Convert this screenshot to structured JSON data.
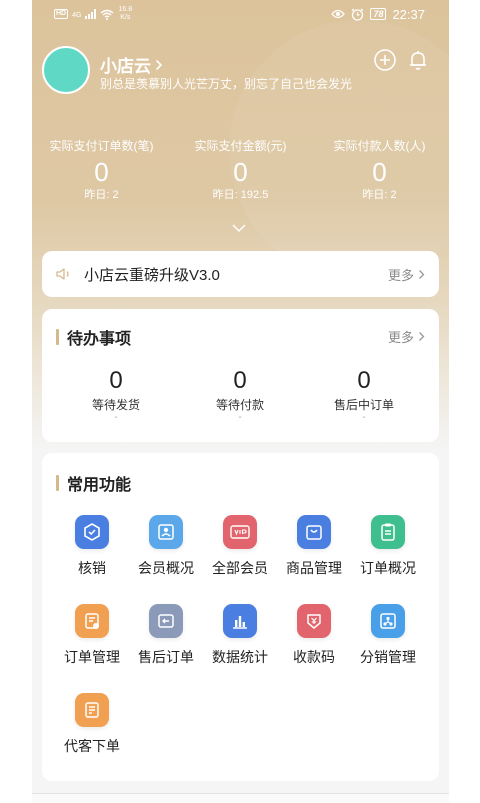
{
  "status_bar": {
    "net_badge": "HD",
    "net_type": "4G",
    "speed_value": "16.8",
    "speed_unit": "K/s",
    "battery": "78",
    "time": "22:37"
  },
  "profile": {
    "shop_name": "小店云",
    "motto": "别总是羡慕别人光芒万丈，别忘了自己也会发光",
    "avatar_color": "#5fd9c6"
  },
  "stats": [
    {
      "label": "实际支付订单数(笔)",
      "value": "0",
      "yesterday": "昨日: 2"
    },
    {
      "label": "实际支付金额(元)",
      "value": "0",
      "yesterday": "昨日: 192.5"
    },
    {
      "label": "实际付款人数(人)",
      "value": "0",
      "yesterday": "昨日: 2"
    }
  ],
  "notice": {
    "text": "小店云重磅升级V3.0",
    "more": "更多"
  },
  "todo": {
    "title": "待办事项",
    "more": "更多",
    "items": [
      {
        "count": "0",
        "label": "等待发货",
        "sub": "-"
      },
      {
        "count": "0",
        "label": "等待付款",
        "sub": "-"
      },
      {
        "count": "0",
        "label": "售后中订单",
        "sub": "-"
      }
    ]
  },
  "functions": {
    "title": "常用功能",
    "items": [
      {
        "label": "核销",
        "icon": "verify-icon",
        "color": "#4a7ee0"
      },
      {
        "label": "会员概况",
        "icon": "member-overview-icon",
        "color": "#5aa8ea"
      },
      {
        "label": "全部会员",
        "icon": "vip-card-icon",
        "color": "#e2646c"
      },
      {
        "label": "商品管理",
        "icon": "goods-bag-icon",
        "color": "#4a7ee0"
      },
      {
        "label": "订单概况",
        "icon": "order-overview-icon",
        "color": "#3fbf8f"
      },
      {
        "label": "订单管理",
        "icon": "order-manage-icon",
        "color": "#f0a050"
      },
      {
        "label": "售后订单",
        "icon": "after-sale-icon",
        "color": "#8a9ab8"
      },
      {
        "label": "数据统计",
        "icon": "bar-chart-icon",
        "color": "#4a7ee0"
      },
      {
        "label": "收款码",
        "icon": "payment-code-icon",
        "color": "#e2646c"
      },
      {
        "label": "分销管理",
        "icon": "distribution-icon",
        "color": "#4aa0e8"
      },
      {
        "label": "代客下单",
        "icon": "proxy-order-icon",
        "color": "#f0a050"
      }
    ]
  },
  "theme": {
    "accent": "#d4b98c",
    "header_gradient_top": "#dcc39c"
  }
}
